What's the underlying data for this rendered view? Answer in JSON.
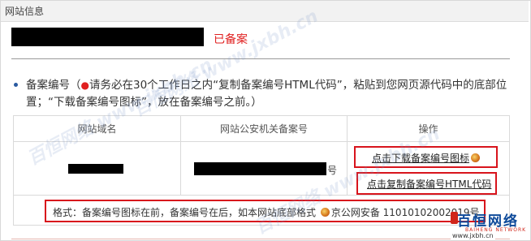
{
  "header": {
    "title": "网站信息"
  },
  "site": {
    "status": "已备案"
  },
  "instruction": {
    "lead": "备案编号（",
    "required_mark": "●",
    "body": "请务必在30个工作日之内“复制备案编号HTML代码”，粘贴到您网页源代码中的底部位置；“下载备案编号图标”，放在备案编号之前。）"
  },
  "table": {
    "headers": [
      "网站域名",
      "网站公安机关备案号",
      "操作"
    ],
    "license_suffix": "号",
    "actions": {
      "download_icon": "点击下载备案编号图标",
      "copy_html": "点击复制备案编号HTML代码"
    },
    "format_note": {
      "prefix": "格式：备案编号图标在前，备案编号在后，如本网站底部格式",
      "example": "京公网安备 11010102002019号"
    }
  },
  "watermark": {
    "text": "百恒网络 www.jxbh.cn"
  },
  "logo": {
    "title": "百恒网络",
    "tagline": "BAIHENG NETWORK",
    "url": "www.jxbh.cn"
  },
  "colors": {
    "status_red": "#e02020",
    "highlight_box": "#d8141c",
    "brand_blue": "#0e4a9a"
  }
}
